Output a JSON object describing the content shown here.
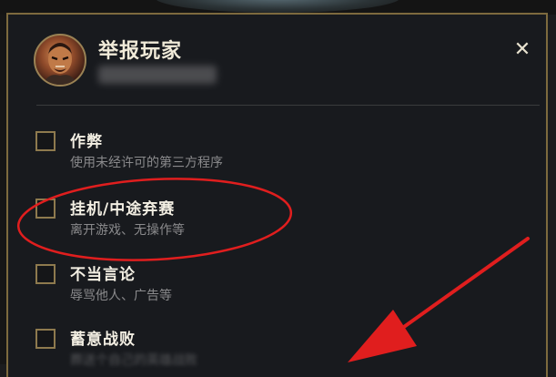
{
  "dialog": {
    "title": "举报玩家",
    "player_name": "",
    "close_label": "✕"
  },
  "options": [
    {
      "title": "作弊",
      "desc": "使用未经许可的第三方程序",
      "checked": false
    },
    {
      "title": "挂机/中途弃赛",
      "desc": "离开游戏、无操作等",
      "checked": false
    },
    {
      "title": "不当言论",
      "desc": "辱骂他人、广告等",
      "checked": false
    },
    {
      "title": "蓄意战败",
      "desc": "葬送个自己的英雄战败",
      "checked": false
    }
  ],
  "colors": {
    "background": "#181a1e",
    "gold_border": "#7d6a3e",
    "checkbox_border": "#8e7a4e",
    "annotation_red": "#e01e1e",
    "title_text": "#f0ead8",
    "desc_text": "#8a8a8c"
  },
  "icons": {
    "close": "close-icon",
    "avatar": "champion-avatar"
  }
}
